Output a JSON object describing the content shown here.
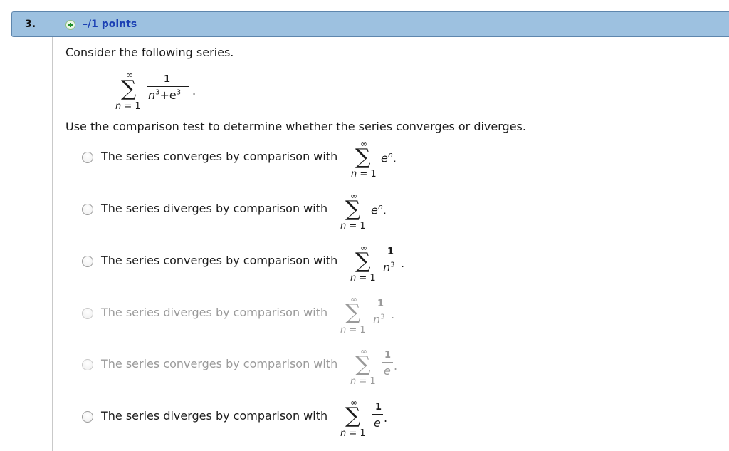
{
  "question": {
    "number": "3.",
    "points": "–/1 points"
  },
  "prompt": "Consider the following series.",
  "series": {
    "sum_upper": "∞",
    "sum_lower_var": "n",
    "sum_lower_eq": " = 1",
    "numerator": "1",
    "denominator_base1": "n",
    "denominator_exp1": "3",
    "denominator_mid": "+e",
    "denominator_exp2": "3",
    "trailing": "."
  },
  "instruction": "Use the comparison test to determine whether the series converges or diverges.",
  "options": [
    {
      "text": "The series converges by comparison with",
      "base": "e",
      "exp": "n",
      "trailing": "."
    },
    {
      "text": "The series diverges by comparison with",
      "base": "e",
      "exp": "n",
      "trailing": "."
    },
    {
      "text": "The series converges by comparison with",
      "num": "1",
      "den": "n",
      "den_exp": "3",
      "trailing": "."
    },
    {
      "text": "The series diverges by comparison with",
      "num": "1",
      "den": "n",
      "den_exp": "3",
      "trailing": "."
    },
    {
      "text": "The series converges by comparison with",
      "num": "1",
      "den": "e",
      "trailing": "."
    },
    {
      "text": "The series diverges by comparison with",
      "num": "1",
      "den": "e",
      "trailing": "."
    }
  ],
  "sum_symbols": {
    "upper": "∞",
    "var": "n",
    "eq": " = 1"
  }
}
